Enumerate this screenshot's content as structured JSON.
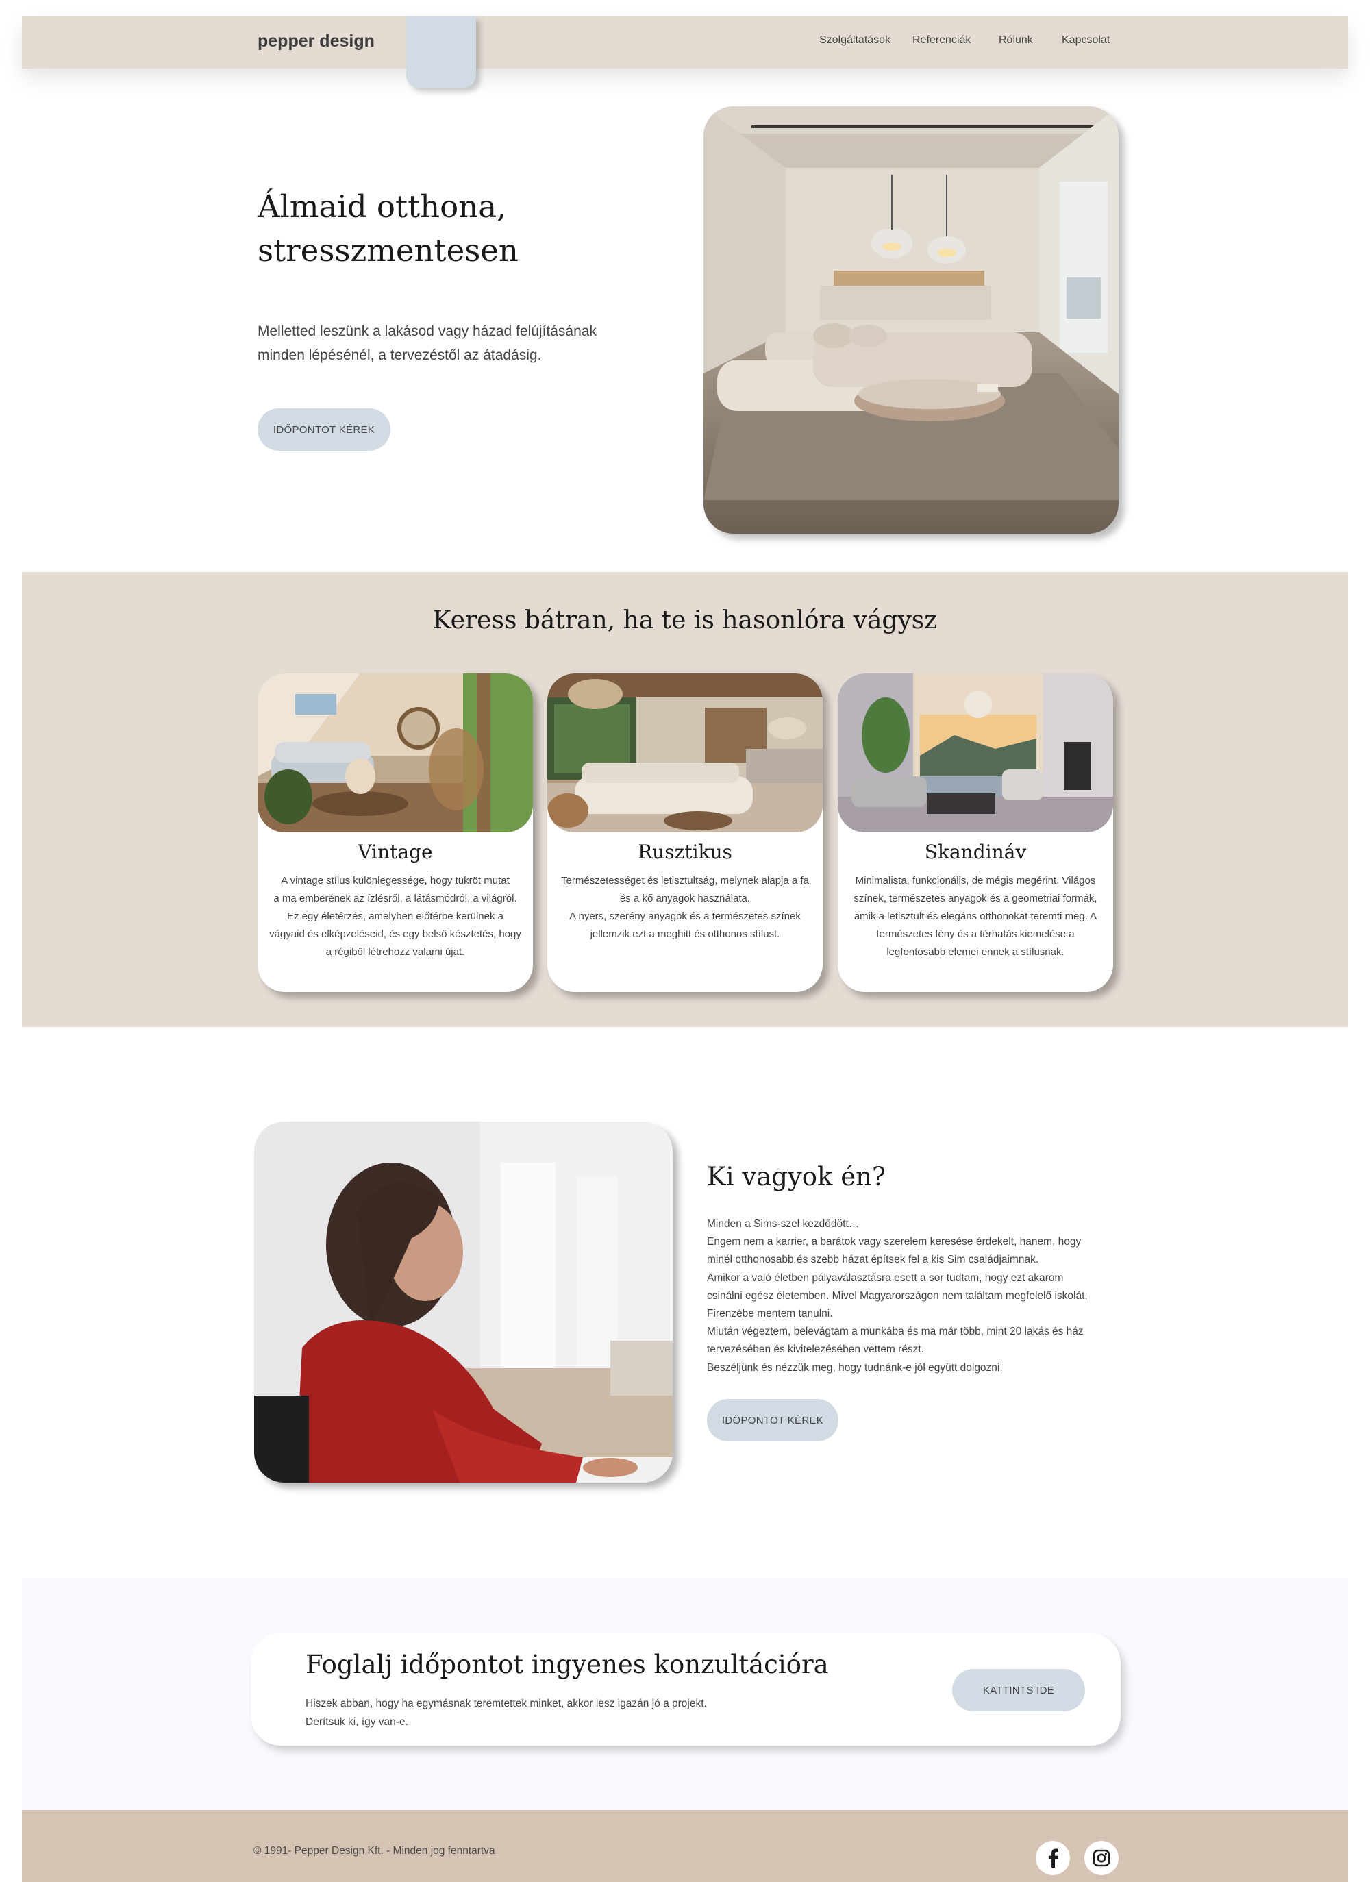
{
  "header": {
    "logo": "pepper design",
    "nav": [
      {
        "label": "Szolgáltatások"
      },
      {
        "label": "Referenciák"
      },
      {
        "label": "Rólunk"
      },
      {
        "label": "Kapcsolat"
      }
    ]
  },
  "hero": {
    "title_line1": "Álmaid otthona,",
    "title_line2": "stresszmentesen",
    "text_line1": "Melletted leszünk a lakásod vagy házad felújításának",
    "text_line2": "minden lépésénél, a tervezéstől az átadásig.",
    "button": "IDŐPONTOT KÉREK",
    "image_icon": "living-room-photo"
  },
  "styles": {
    "title": "Keress bátran, ha te is hasonlóra vágysz",
    "cards": [
      {
        "name": "Vintage",
        "desc": [
          "A vintage stílus különlegessége, hogy tükröt mutat",
          "a ma emberének az ízlésről, a látásmódról, a világról.",
          "Ez egy életérzés, amelyben előtérbe kerülnek a",
          "vágyaid és elképzeléseid, és egy belső késztetés, hogy",
          "a régiből létrehozz valami újat."
        ]
      },
      {
        "name": "Rusztikus",
        "desc": [
          "Természetességet és letisztultság, melynek alapja a fa",
          "és a kő anyagok használata.",
          "A nyers, szerény anyagok és a természetes színek",
          "jellemzik ezt a meghitt és otthonos stílust."
        ]
      },
      {
        "name": "Skandináv",
        "desc": [
          "Minimalista, funkcionális, de mégis megérint. Világos",
          "színek, természetes anyagok és a geometriai formák,",
          "amik a letisztult és elegáns otthonokat teremti meg. A",
          "természetes fény és a térhatás kiemelése a",
          "legfontosabb elemei ennek a stílusnak."
        ]
      }
    ]
  },
  "about": {
    "title": "Ki vagyok én?",
    "paragraphs": [
      "Minden a Sims-szel kezdődött…",
      "Engem nem a karrier, a barátok vagy szerelem keresése érdekelt, hanem, hogy",
      "minél otthonosabb és szebb házat építsek fel a kis Sim családjaimnak.",
      "Amikor a való életben pályaválasztásra esett a sor tudtam, hogy ezt akarom",
      "csinálni egész életemben. Mivel Magyarországon nem találtam megfelelő iskolát,",
      "Firenzébe mentem tanulni.",
      "Miután végeztem, belevágtam a munkába és ma már több, mint 20 lakás és ház",
      "tervezésében és kivitelezésében vettem részt.",
      "Beszéljünk és nézzük meg, hogy tudnánk-e jól együtt dolgozni."
    ],
    "button": "IDŐPONTOT KÉREK"
  },
  "cta": {
    "title": "Foglalj időpontot ingyenes konzultációra",
    "text_line1": "Hiszek abban, hogy ha egymásnak teremtettek minket, akkor lesz igazán jó a projekt.",
    "text_line2": "Derítsük ki, így van-e.",
    "button": "KATTINTS IDE"
  },
  "footer": {
    "copyright": "© 1991- Pepper Design Kft. - Minden jog fenntartva",
    "social": [
      "facebook-icon",
      "instagram-icon"
    ]
  },
  "colors": {
    "beige": "#e4dcd3",
    "button": "#d2dbe3",
    "footer": "#d5c3b3",
    "cta_band": "#f8f9fd"
  }
}
